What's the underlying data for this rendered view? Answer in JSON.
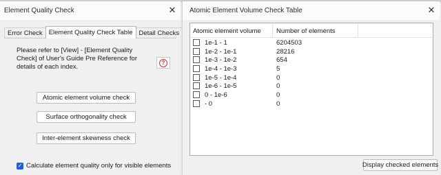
{
  "left_window": {
    "title": "Element Quality Check",
    "close": "✕",
    "tabs": [
      {
        "label": "Error Check",
        "active": false
      },
      {
        "label": "Element Quality Check Table",
        "active": true
      },
      {
        "label": "Detail Checks",
        "active": false
      }
    ],
    "reference_text": "Please refer to [View] - [Element Quality Check] of User's Guide Pre Reference for details of each index.",
    "help_icon": "question-circle-icon",
    "buttons": {
      "atomic": "Atomic element volume check",
      "surface": "Surface orthogonality check",
      "skewness": "Inter-element skewness check"
    },
    "visible_only": {
      "checked": true,
      "label": "Calculate element quality only for visible elements"
    }
  },
  "right_window": {
    "title": "Atomic Element Volume Check Table",
    "close": "✕",
    "columns": [
      "Atomic element volume",
      "Number of elements"
    ],
    "rows": [
      {
        "range": "1e-1 - 1",
        "count": "6204503",
        "checked": false
      },
      {
        "range": "1e-2 - 1e-1",
        "count": "28216",
        "checked": false
      },
      {
        "range": "1e-3 - 1e-2",
        "count": "654",
        "checked": false
      },
      {
        "range": "1e-4 - 1e-3",
        "count": "5",
        "checked": false
      },
      {
        "range": "1e-5 - 1e-4",
        "count": "0",
        "checked": false
      },
      {
        "range": "1e-6 - 1e-5",
        "count": "0",
        "checked": false
      },
      {
        "range": "0 - 1e-6",
        "count": "0",
        "checked": false
      },
      {
        "range": "- 0",
        "count": "0",
        "checked": false
      }
    ],
    "display_button": "Display checked elements"
  },
  "colors": {
    "accent": "#1e5fd6",
    "help_icon": "#c0392b"
  }
}
